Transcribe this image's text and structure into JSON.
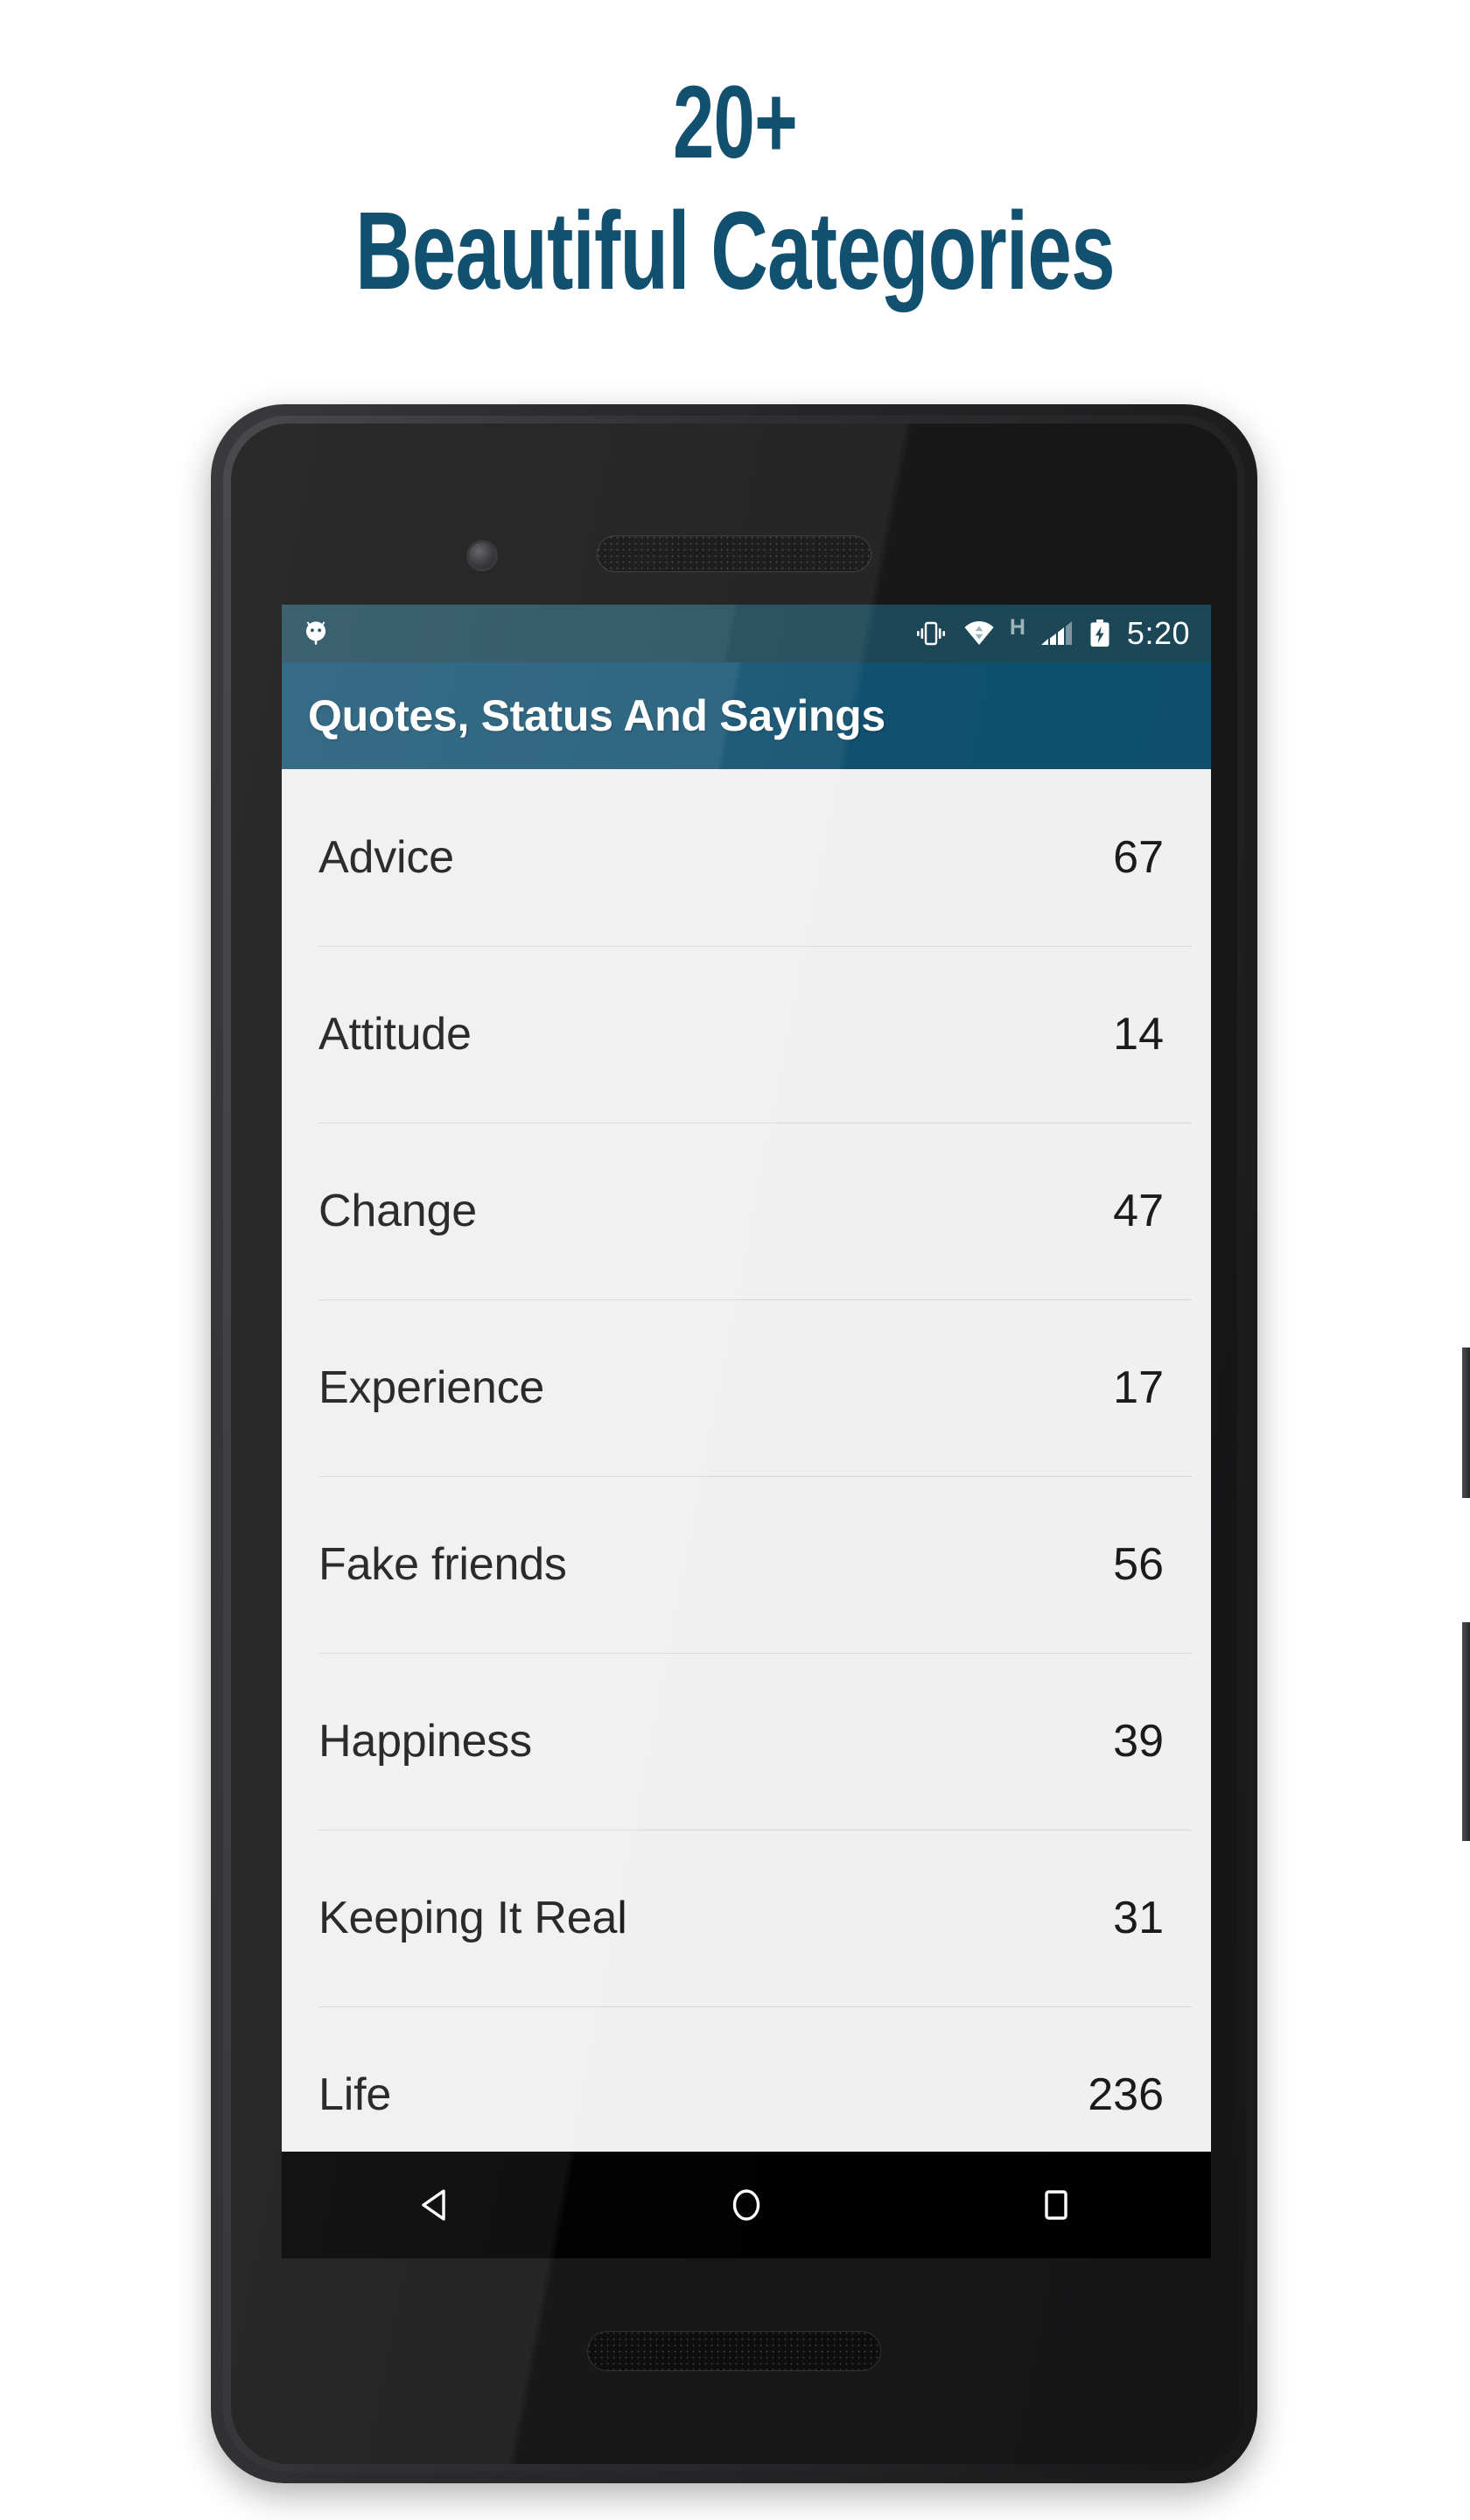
{
  "promo": {
    "headline_line1": "20+",
    "headline_line2": "Beautiful Categories",
    "headline_color": "#11506f"
  },
  "device": {
    "frame_color": "#2c2c2e",
    "hardware": {
      "earpiece": "earpiece-speaker",
      "front_camera": "front-camera",
      "bottom_speaker": "bottom-speaker",
      "power_button": "power-button",
      "volume_button": "volume-rocker"
    }
  },
  "status_bar": {
    "background": "#1b4655",
    "notification_icon": "android-robot-icon",
    "icons": [
      "vibrate-icon",
      "wifi-data-transfer-icon",
      "network-type-h-icon",
      "signal-bars-icon",
      "battery-charging-icon"
    ],
    "network_type": "H",
    "time": "5:20"
  },
  "app_bar": {
    "title": "Quotes, Status And Sayings",
    "background": "#0f4f6e",
    "text_color": "#ffffff"
  },
  "list": {
    "background": "#f0f0f0",
    "divider_color": "#d9d9d9",
    "text_color": "#1a1a1a",
    "rows": [
      {
        "name": "Advice",
        "count": "67"
      },
      {
        "name": "Attitude",
        "count": "14"
      },
      {
        "name": "Change",
        "count": "47"
      },
      {
        "name": "Experience",
        "count": "17"
      },
      {
        "name": "Fake friends",
        "count": "56"
      },
      {
        "name": "Happiness",
        "count": "39"
      },
      {
        "name": "Keeping It Real",
        "count": "31"
      },
      {
        "name": "Life",
        "count": "236"
      }
    ]
  },
  "nav_bar": {
    "background": "#000000",
    "buttons": [
      {
        "name": "back-button",
        "icon": "triangle-left-icon"
      },
      {
        "name": "home-button",
        "icon": "circle-icon"
      },
      {
        "name": "recents-button",
        "icon": "square-icon"
      }
    ]
  }
}
